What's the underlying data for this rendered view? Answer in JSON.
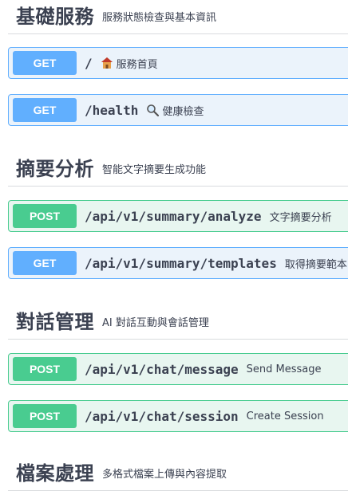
{
  "sections": [
    {
      "title": "基礎服務",
      "description": "服務狀態檢查與基本資訊",
      "operations": [
        {
          "method": "GET",
          "path": "/",
          "icon": "house-icon",
          "summary": "服務首頁"
        },
        {
          "method": "GET",
          "path": "/health",
          "icon": "magnifier-icon",
          "summary": "健康檢查"
        }
      ]
    },
    {
      "title": "摘要分析",
      "description": "智能文字摘要生成功能",
      "operations": [
        {
          "method": "POST",
          "path": "/api/v1/summary/analyze",
          "summary": "文字摘要分析"
        },
        {
          "method": "GET",
          "path": "/api/v1/summary/templates",
          "summary": "取得摘要範本"
        }
      ]
    },
    {
      "title": "對話管理",
      "description": "AI 對話互動與會話管理",
      "operations": [
        {
          "method": "POST",
          "path": "/api/v1/chat/message",
          "summary": "Send Message"
        },
        {
          "method": "POST",
          "path": "/api/v1/chat/session",
          "summary": "Create Session"
        }
      ]
    },
    {
      "title": "檔案處理",
      "description": "多格式檔案上傳與內容提取",
      "operations": []
    }
  ],
  "colors": {
    "get": "#61affe",
    "post": "#49cc90"
  }
}
